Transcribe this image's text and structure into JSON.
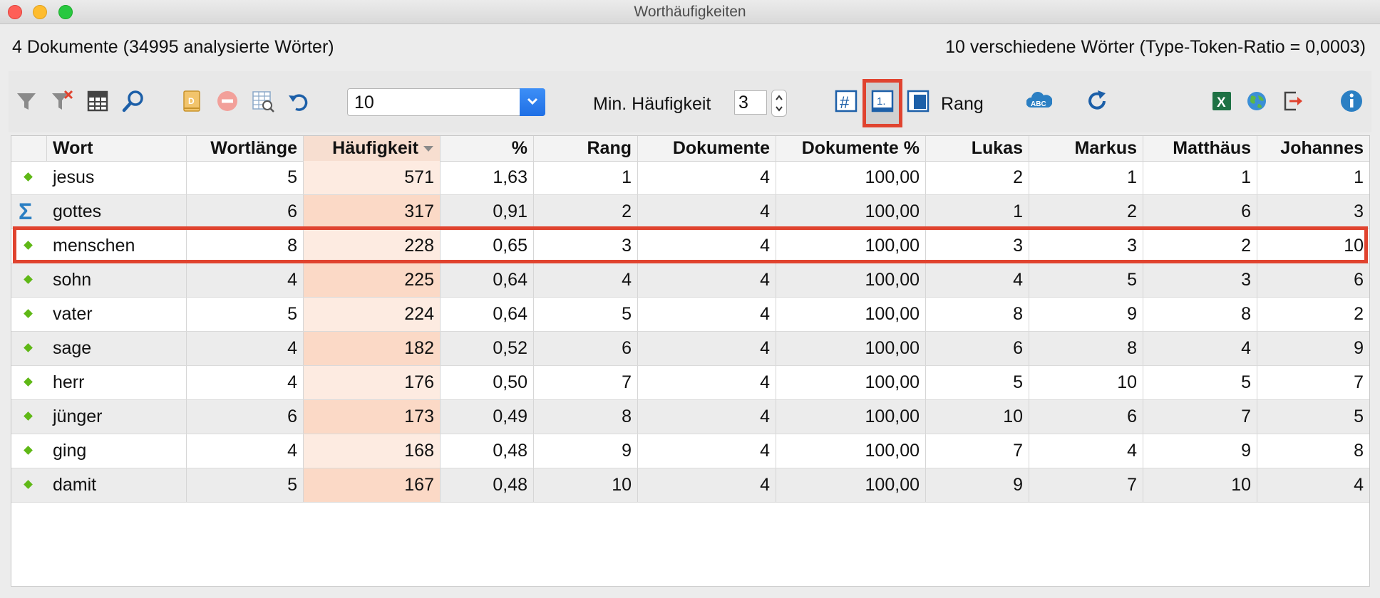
{
  "window": {
    "title": "Worthäufigkeiten"
  },
  "info": {
    "documents": "4 Dokumente (34995 analysierte Wörter)",
    "types": "10 verschiedene Wörter (Type-Token-Ratio = 0,0003)"
  },
  "toolbar": {
    "combo_value": "10",
    "min_freq_label": "Min. Häufigkeit",
    "min_freq_value": "3",
    "rank_label": "Rang",
    "icons": [
      "filter-icon",
      "clear-filter-icon",
      "columns-icon",
      "search-icon",
      "document-icon",
      "remove-icon",
      "table-search-icon",
      "undo-icon",
      "hash-icon",
      "rank-icon",
      "percent-icon",
      "word-cloud-icon",
      "refresh-icon",
      "excel-icon",
      "globe-icon",
      "export-icon",
      "info-icon"
    ]
  },
  "colors": {
    "highlight": "#e0432f",
    "sorted_column": "#f7ded0",
    "accent": "#1f6fe5"
  },
  "table": {
    "headers": [
      "",
      "Wort",
      "Wortlänge",
      "Häufigkeit",
      "%",
      "Rang",
      "Dokumente",
      "Dokumente %",
      "Lukas",
      "Markus",
      "Matthäus",
      "Johannes"
    ],
    "sorted_column": "Häufigkeit",
    "rows": [
      {
        "marker": "diamond",
        "cells": [
          "jesus",
          "5",
          "571",
          "1,63",
          "1",
          "4",
          "100,00",
          "2",
          "1",
          "1",
          "1"
        ]
      },
      {
        "marker": "sigma",
        "cells": [
          "gottes",
          "6",
          "317",
          "0,91",
          "2",
          "4",
          "100,00",
          "1",
          "2",
          "6",
          "3"
        ]
      },
      {
        "marker": "diamond",
        "cells": [
          "menschen",
          "8",
          "228",
          "0,65",
          "3",
          "4",
          "100,00",
          "3",
          "3",
          "2",
          "10"
        ]
      },
      {
        "marker": "diamond",
        "cells": [
          "sohn",
          "4",
          "225",
          "0,64",
          "4",
          "4",
          "100,00",
          "4",
          "5",
          "3",
          "6"
        ]
      },
      {
        "marker": "diamond",
        "cells": [
          "vater",
          "5",
          "224",
          "0,64",
          "5",
          "4",
          "100,00",
          "8",
          "9",
          "8",
          "2"
        ]
      },
      {
        "marker": "diamond",
        "cells": [
          "sage",
          "4",
          "182",
          "0,52",
          "6",
          "4",
          "100,00",
          "6",
          "8",
          "4",
          "9"
        ]
      },
      {
        "marker": "diamond",
        "cells": [
          "herr",
          "4",
          "176",
          "0,50",
          "7",
          "4",
          "100,00",
          "5",
          "10",
          "5",
          "7"
        ]
      },
      {
        "marker": "diamond",
        "cells": [
          "jünger",
          "6",
          "173",
          "0,49",
          "8",
          "4",
          "100,00",
          "10",
          "6",
          "7",
          "5"
        ]
      },
      {
        "marker": "diamond",
        "cells": [
          "ging",
          "4",
          "168",
          "0,48",
          "9",
          "4",
          "100,00",
          "7",
          "4",
          "9",
          "8"
        ]
      },
      {
        "marker": "diamond",
        "cells": [
          "damit",
          "5",
          "167",
          "0,48",
          "10",
          "4",
          "100,00",
          "9",
          "7",
          "10",
          "4"
        ]
      }
    ]
  }
}
